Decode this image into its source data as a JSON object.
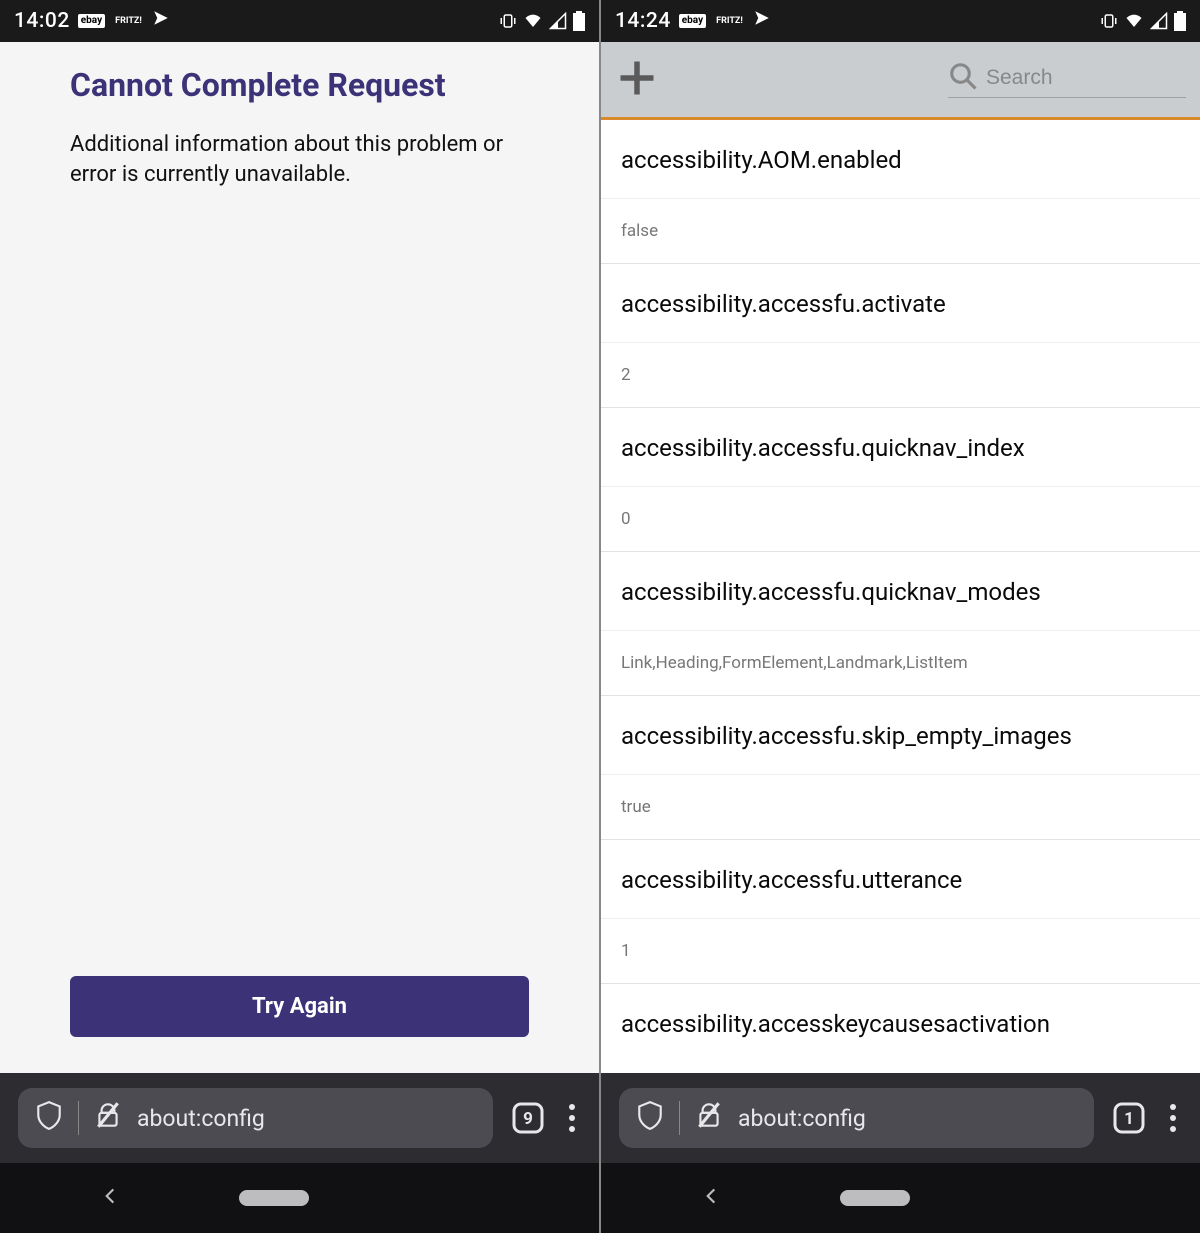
{
  "left": {
    "statusbar": {
      "time": "14:02",
      "badges": [
        "ebay",
        "FRITZ!",
        "✔"
      ]
    },
    "error": {
      "title": "Cannot Complete Request",
      "body": "Additional information about this problem or error is currently unavailable.",
      "button": "Try Again"
    },
    "browser": {
      "url": "about:config",
      "tabs": "9"
    }
  },
  "right": {
    "statusbar": {
      "time": "14:24",
      "badges": [
        "ebay",
        "FRITZ!",
        "✔"
      ]
    },
    "search": {
      "placeholder": "Search"
    },
    "prefs": [
      {
        "name": "accessibility.AOM.enabled",
        "value": "false"
      },
      {
        "name": "accessibility.accessfu.activate",
        "value": "2"
      },
      {
        "name": "accessibility.accessfu.quicknav_index",
        "value": "0"
      },
      {
        "name": "accessibility.accessfu.quicknav_modes",
        "value": "Link,Heading,FormElement,Landmark,ListItem"
      },
      {
        "name": "accessibility.accessfu.skip_empty_images",
        "value": "true"
      },
      {
        "name": "accessibility.accessfu.utterance",
        "value": "1"
      }
    ],
    "last_pref_name": "accessibility.accesskeycausesactivation",
    "browser": {
      "url": "about:config",
      "tabs": "1"
    }
  }
}
